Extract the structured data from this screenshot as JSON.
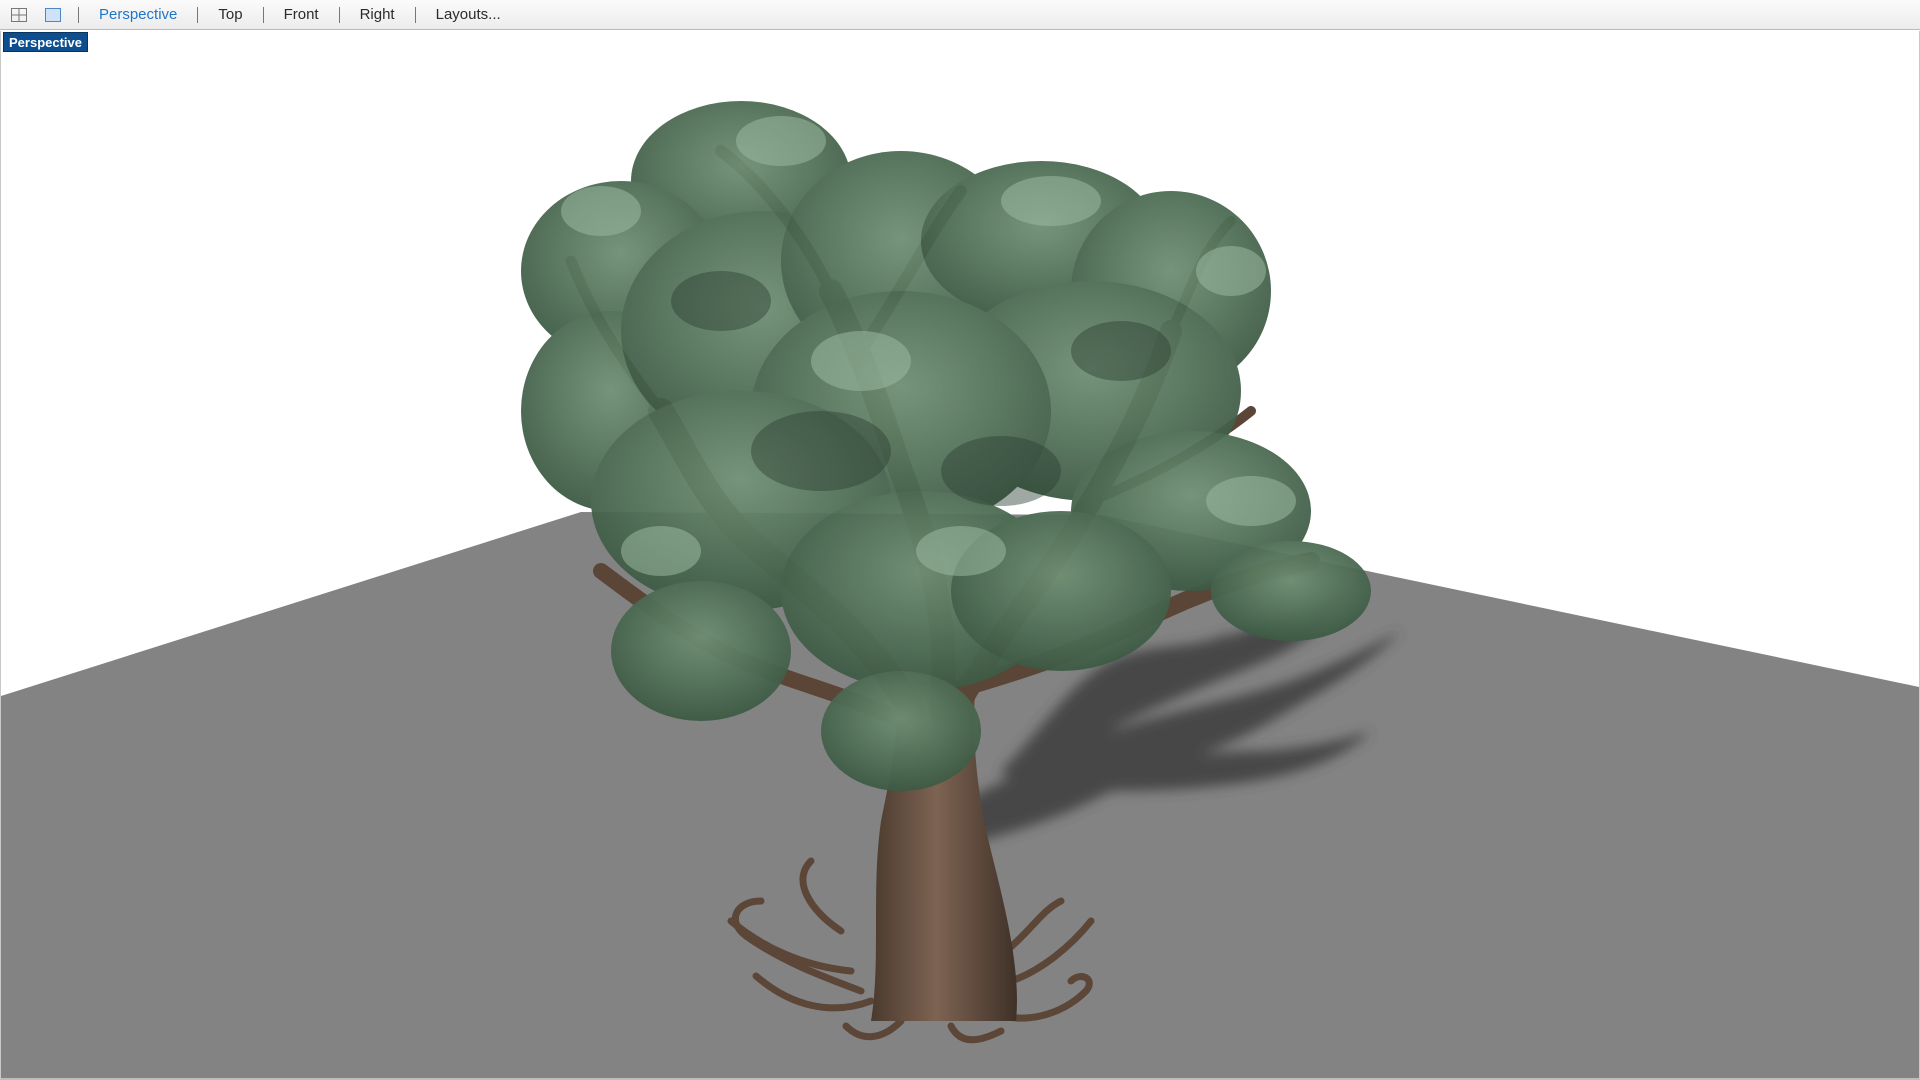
{
  "toolbar": {
    "icons": [
      "four-viewport-layout-icon",
      "single-viewport-layout-icon"
    ],
    "tabs": [
      {
        "label": "Perspective",
        "active": true
      },
      {
        "label": "Top",
        "active": false
      },
      {
        "label": "Front",
        "active": false
      },
      {
        "label": "Right",
        "active": false
      },
      {
        "label": "Layouts...",
        "active": false
      }
    ]
  },
  "viewport": {
    "label": "Perspective",
    "colors": {
      "background": "#ffffff",
      "ground": "#838383",
      "shadow": "#3e3e3e",
      "bark": "#6e5544",
      "foliage": "#4e6f55",
      "label_bg": "#0e4e8e",
      "active_tab": "#1f76c9"
    }
  }
}
